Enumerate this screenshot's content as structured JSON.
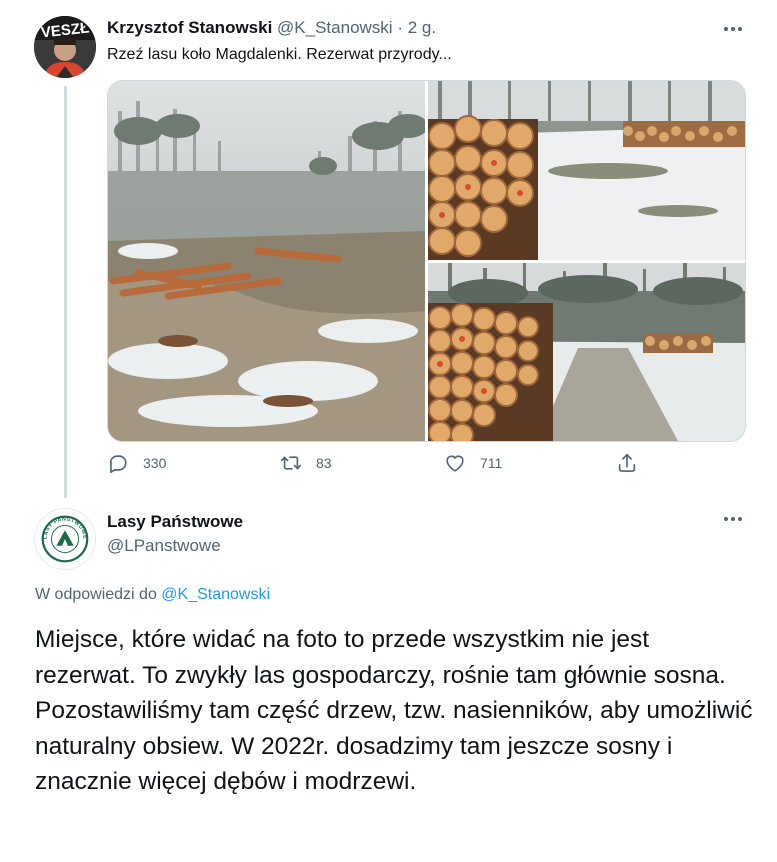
{
  "tweet1": {
    "author_name": "Krzysztof Stanowski",
    "handle": "@K_Stanowski",
    "separator": "·",
    "time": "2 g.",
    "text": "Rzeź lasu koło Magdalenki. Rezerwat przyrody...",
    "avatar_text": "VESZŁ",
    "stats": {
      "replies": "330",
      "retweets": "83",
      "likes": "711"
    },
    "icons": {
      "reply": "reply-icon",
      "retweet": "retweet-icon",
      "like": "heart-icon",
      "share": "share-icon",
      "more": "more-icon"
    }
  },
  "tweet2": {
    "author_name": "Lasy Państwowe",
    "handle": "@LPanstwowe",
    "logo_text": "LASY PAŃSTWOWE",
    "reply_prefix": "W odpowiedzi do",
    "reply_to": "@K_Stanowski",
    "body": "Miejsce, które widać na foto to przede wszystkim nie jest rezerwat. To zwykły las gospodarczy, rośnie tam głównie sosna. Pozostawiliśmy tam część drzew, tzw. nasienników, aby umożliwić naturalny obsiew. W 2022r. dosadzimy tam jeszcze sosny i znacznie więcej dębów i modrzewi."
  },
  "colors": {
    "text_primary": "#0f1419",
    "text_secondary": "#536471",
    "link": "#1d9bf0",
    "thread_line": "#cfd9de",
    "logo_green": "#1c6b48"
  }
}
